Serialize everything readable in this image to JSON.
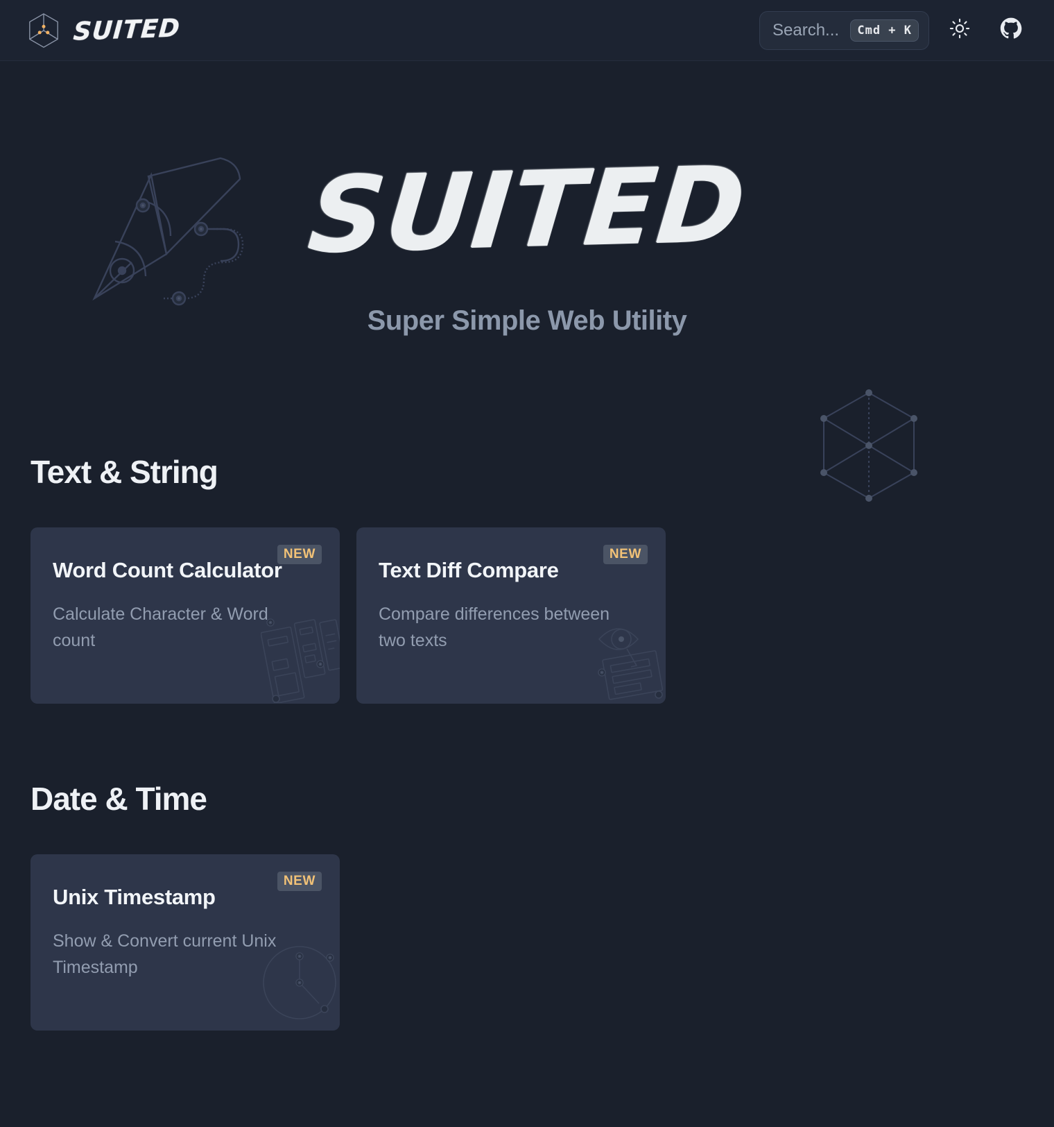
{
  "header": {
    "brand_name": "SUITED",
    "logo_icon": "hex-cube-icon",
    "search": {
      "placeholder": "Search...",
      "shortcut": "Cmd  +  K"
    },
    "theme_toggle_icon": "sun-icon",
    "github_icon": "github-icon"
  },
  "hero": {
    "logo_text": "SUITED",
    "subtitle": "Super Simple Web Utility",
    "decoration_left_icon": "fountain-pen-icon",
    "decoration_right_icon": "hexagon-wireframe-icon"
  },
  "sections": [
    {
      "title": "Text & String",
      "cards": [
        {
          "title": "Word Count Calculator",
          "description": "Calculate Character & Word count",
          "badge": "NEW",
          "art_icon": "documents-icon"
        },
        {
          "title": "Text Diff Compare",
          "description": "Compare differences between two texts",
          "badge": "NEW",
          "art_icon": "eye-document-icon"
        }
      ]
    },
    {
      "title": "Date & Time",
      "cards": [
        {
          "title": "Unix Timestamp",
          "description": "Show & Convert current Unix Timestamp",
          "badge": "NEW",
          "art_icon": "clock-icon"
        }
      ]
    }
  ],
  "colors": {
    "page_background": "#1a202c",
    "header_background": "#1c2331",
    "card_background": "#2e364a",
    "badge_background": "#4b5465",
    "badge_text": "#f2c277",
    "accent": "#f2b263",
    "text_primary": "#eef1f5",
    "text_muted": "#929db0"
  }
}
